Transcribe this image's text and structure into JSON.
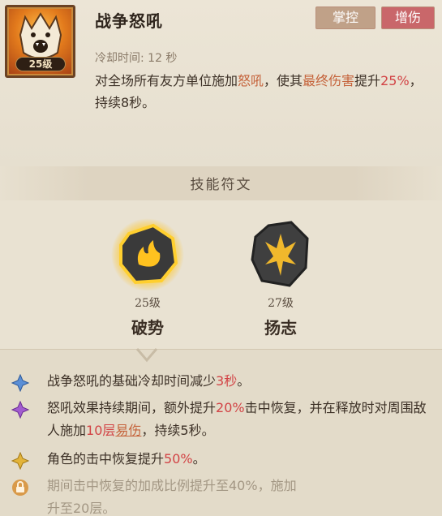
{
  "skill": {
    "name": "战争怒吼",
    "level": "25级",
    "tags": [
      "掌控",
      "增伤"
    ],
    "cooldown": "冷却时间: 12 秒",
    "desc": {
      "p1": "对全场所有友方单位施加",
      "k1": "怒吼",
      "p2": "，使其",
      "k2": "最终伤害",
      "p3": "提升",
      "k3": "25%",
      "p4": "，持续8秒。"
    }
  },
  "runes": {
    "heading": "技能符文",
    "items": [
      {
        "level": "25级",
        "name": "破势"
      },
      {
        "level": "27级",
        "name": "扬志"
      }
    ]
  },
  "effects": [
    {
      "gem": "blue",
      "parts": [
        "战争怒吼的基础冷却时间减少",
        "3秒",
        "。"
      ]
    },
    {
      "gem": "purple",
      "parts": [
        "怒吼效果持续期间，额外提升",
        "20%",
        "击中恢复，并在释放时对周围敌人施加",
        "10层",
        "易伤",
        "，持续5秒。"
      ]
    },
    {
      "gem": "gold",
      "parts": [
        "角色的击中恢复提升",
        "50%",
        "。"
      ]
    },
    {
      "gem": "lock",
      "parts": [
        "期间击中恢复的加成比例提升至40%，施加",
        "升至20层。"
      ]
    }
  ],
  "colors": {
    "accent_red": "#d24345",
    "accent_orange": "#c5633b",
    "tag_control": "#c0a188",
    "tag_damage": "#c9676a"
  }
}
